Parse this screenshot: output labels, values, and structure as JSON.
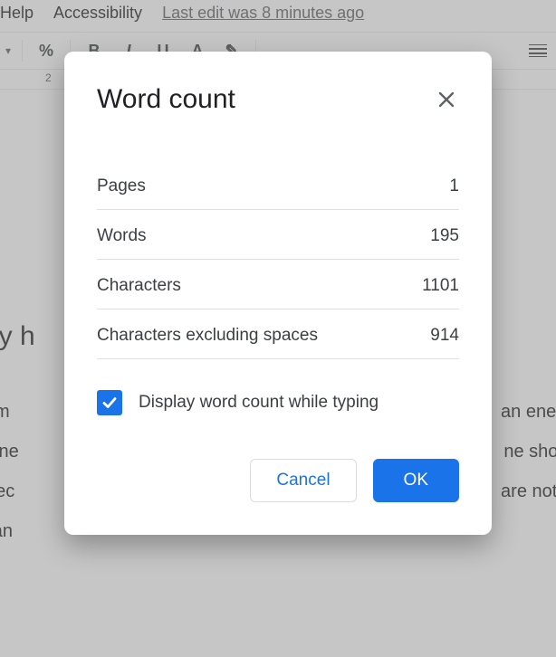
{
  "menubar": {
    "help": "Help",
    "accessibility": "Accessibility",
    "edit_status": "Last edit was 8 minutes ago"
  },
  "toolbar": {
    "zoom_chevron": "▾",
    "percent": "%",
    "bold": "B",
    "italic": "I",
    "underline": "U",
    "text_color": "A",
    "highlight": "✎",
    "more": "⋯"
  },
  "ruler": {
    "mark2": "2"
  },
  "document": {
    "heading": "ery h",
    "line1_left": "on to m",
    "line1_right": "an energ",
    "line2_left": "s Iphone",
    "line2_right": "ne shoul",
    "line3_left": "t will rec",
    "line3_right": "are not u",
    "line4_left": "you can"
  },
  "dialog": {
    "title": "Word count",
    "rows": [
      {
        "label": "Pages",
        "value": "1"
      },
      {
        "label": "Words",
        "value": "195"
      },
      {
        "label": "Characters",
        "value": "1101"
      },
      {
        "label": "Characters excluding spaces",
        "value": "914"
      }
    ],
    "checkbox_label": "Display word count while typing",
    "checkbox_checked": true,
    "cancel": "Cancel",
    "ok": "OK"
  }
}
